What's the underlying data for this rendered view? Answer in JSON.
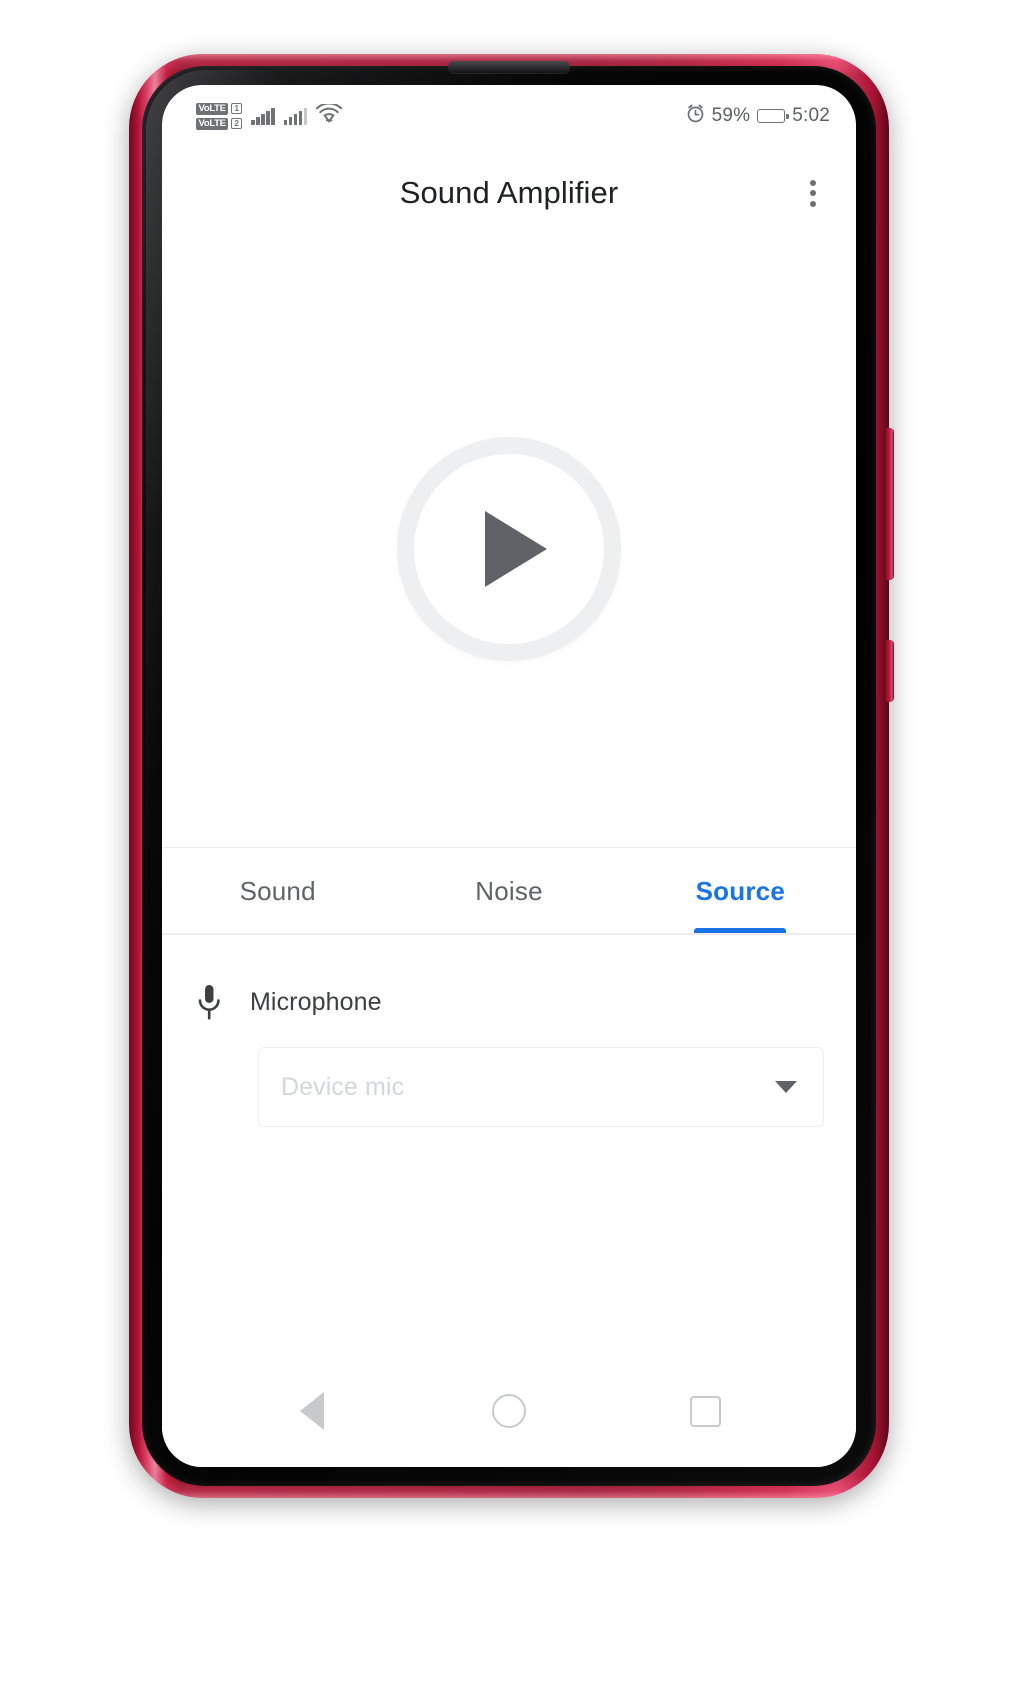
{
  "device": {
    "frame_color": "#a81233",
    "earpiece": "earpiece-speaker"
  },
  "status_bar": {
    "volte": [
      {
        "tag": "VoLTE",
        "sim": "1"
      },
      {
        "tag": "VoLTE",
        "sim": "2"
      }
    ],
    "signal_1": "signal-bars-icon",
    "signal_2": "signal-bars-icon",
    "wifi": "wifi-icon",
    "alarm": "alarm-icon",
    "battery_percent": "59%",
    "battery_level": 59,
    "battery": "battery-icon",
    "time": "5:02"
  },
  "app_bar": {
    "title": "Sound Amplifier",
    "overflow": "overflow-menu-icon"
  },
  "player": {
    "state": "stopped",
    "button_icon": "play-icon",
    "accent_ring": "#eeeff0"
  },
  "tabs": {
    "active_index": 2,
    "accent": "#1a73e8",
    "items": [
      {
        "label": "Sound"
      },
      {
        "label": "Noise"
      },
      {
        "label": "Source"
      }
    ]
  },
  "source_panel": {
    "mic_icon": "microphone-icon",
    "mic_label": "Microphone",
    "mic_select": {
      "value": "Device mic",
      "placeholder": "Device mic",
      "arrow_icon": "chevron-down-icon"
    }
  },
  "nav_bar": {
    "back": "back-icon",
    "home": "home-icon",
    "recents": "recents-icon"
  }
}
